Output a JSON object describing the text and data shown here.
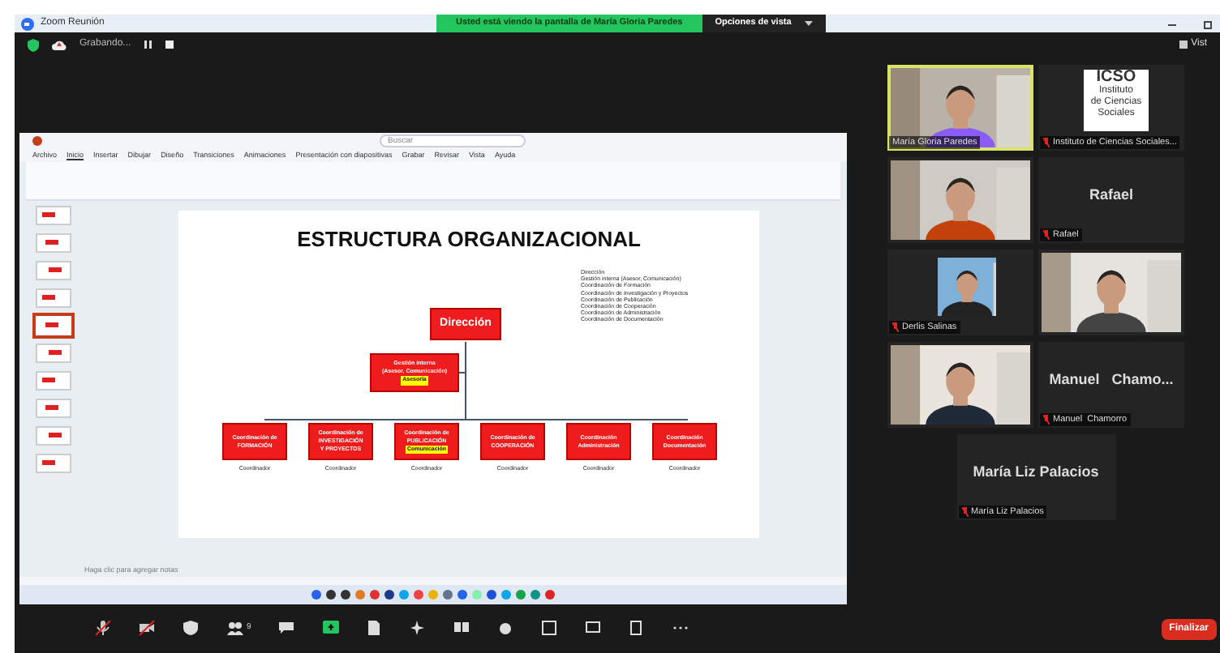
{
  "window": {
    "title": "Zoom Reunión",
    "banner": "Usted está viendo la pantalla de María Gloria Paredes",
    "view_options": "Opciones de vista",
    "recording": "Grabando...",
    "view_button": "Vist"
  },
  "shared_screen": {
    "search": {
      "placeholder": "Buscar"
    },
    "menu": [
      "Archivo",
      "Inicio",
      "Insertar",
      "Dibujar",
      "Diseño",
      "Transiciones",
      "Animaciones",
      "Presentación con diapositivas",
      "Grabar",
      "Revisar",
      "Vista",
      "Ayuda"
    ],
    "thumbnails": [
      {
        "selected": false
      },
      {
        "selected": false
      },
      {
        "selected": false
      },
      {
        "selected": false
      },
      {
        "selected": true
      },
      {
        "selected": false
      },
      {
        "selected": false
      },
      {
        "selected": false
      },
      {
        "selected": false
      },
      {
        "selected": false
      }
    ],
    "slide": {
      "title": "ESTRUCTURA ORGANIZACIONAL",
      "legend": [
        "Dirección",
        "Gestión interna (Asesor, Comunicación)",
        "Coordinación de Formación",
        "Coordinación de Investigación y Proyectos",
        "Coordinación de Publicación",
        "Coordinación de Cooperación",
        "Coordinación de Administración",
        "Coordinación de Documentación"
      ],
      "top": "Dirección",
      "staff": {
        "lines": [
          "Gestión interna",
          "(Asesor, Comunicación)"
        ],
        "highlight": "Asesoría"
      },
      "units": [
        {
          "lines": [
            "Coordinación de",
            "FORMACIÓN"
          ],
          "role": "Coordinador"
        },
        {
          "lines": [
            "Coordinación de",
            "INVESTIGACIÓN",
            "Y PROYECTOS"
          ],
          "role": "Coordinador"
        },
        {
          "lines": [
            "Coordinación de",
            "PUBLICACIÓN"
          ],
          "highlight": "Comunicación",
          "role": "Coordinador"
        },
        {
          "lines": [
            "Coordinación de",
            "COOPERACIÓN"
          ],
          "role": "Coordinador"
        },
        {
          "lines": [
            "Coordinación",
            "Administración"
          ],
          "role": "Coordinador"
        },
        {
          "lines": [
            "Coordinación",
            "Documentación"
          ],
          "role": "Coordinador"
        }
      ]
    },
    "notes": {
      "placeholder": "Haga clic para agregar notas"
    }
  },
  "participants": [
    {
      "kind": "video",
      "label": "María Gloria Paredes",
      "muted": false,
      "selected": true
    },
    {
      "kind": "logo",
      "logo": [
        "ICSO",
        "Instituto",
        "de Ciencias",
        "Sociales"
      ],
      "label": "Instituto de Ciencias Sociales...",
      "muted": true,
      "selected": false
    },
    {
      "kind": "video",
      "selected": false
    },
    {
      "kind": "name",
      "name": "Rafael",
      "label": "Rafael",
      "muted": true,
      "selected": false
    },
    {
      "kind": "small_video",
      "label": "Derlis Salinas",
      "muted": true,
      "selected": false
    },
    {
      "kind": "video",
      "selected": false
    },
    {
      "kind": "video",
      "selected": false
    },
    {
      "kind": "name",
      "name": "Manuel   Chamo...",
      "label": "Manuel  Chamorro",
      "muted": true,
      "selected": false
    },
    {
      "kind": "name",
      "name": "María Liz Palacios",
      "label": "María Liz Palacios",
      "muted": true,
      "selected": false
    }
  ],
  "toolbar": {
    "participants_count": "9",
    "end_button": "Finalizar"
  }
}
